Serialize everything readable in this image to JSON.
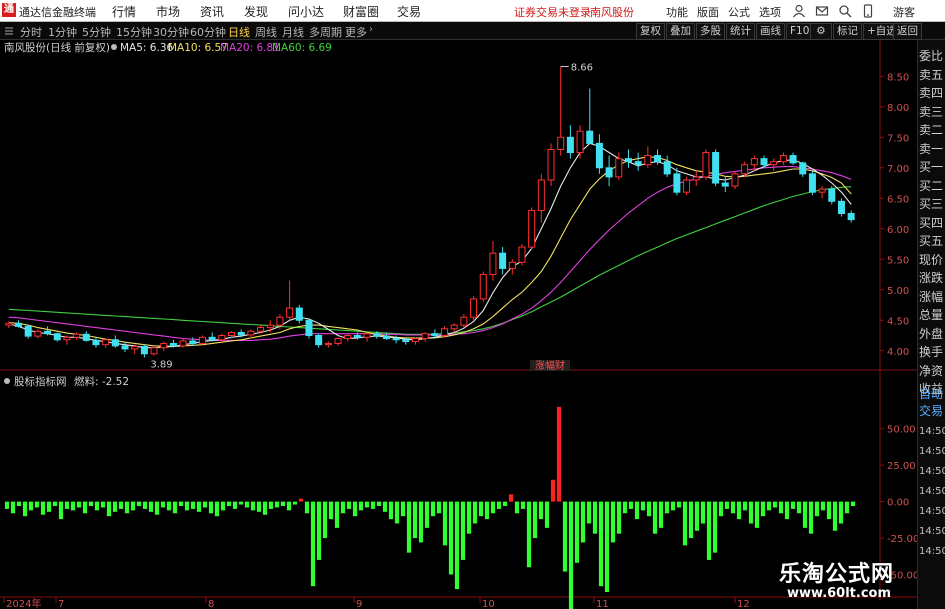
{
  "titlebar": {
    "logo": "通",
    "app_title": "通达信金融终端",
    "menu": [
      "行情",
      "市场",
      "资讯",
      "发现",
      "问小达",
      "财富圈",
      "交易"
    ],
    "notice": "证券交易未登录",
    "stock_tab": "南风股份",
    "right_items": [
      "功能",
      "版面",
      "公式",
      "选项"
    ],
    "guest": "游客"
  },
  "toolbar": {
    "periods": [
      "分时",
      "1分钟",
      "5分钟",
      "15分钟",
      "30分钟",
      "60分钟",
      "日线",
      "周线",
      "月线",
      "多周期",
      "更多"
    ],
    "active_period": "日线",
    "buttons": [
      "复权",
      "叠加",
      "多股",
      "统计",
      "画线",
      "F10",
      "标记",
      "+自选",
      "返回"
    ]
  },
  "main_chart": {
    "info": {
      "name": "南风股份(日线 前复权)",
      "ma5": "MA5: 6.36",
      "ma10": "MA10: 6.57",
      "ma20": "MA20: 6.81",
      "ma60": "MA60: 6.69"
    },
    "colors": {
      "ma5": "#e8e8e8",
      "ma10": "#f0e060",
      "ma20": "#e040e0",
      "ma60": "#40d040",
      "up": "#ff3030",
      "down": "#40e0f0"
    },
    "high_label": "8.66",
    "low_label": "3.89",
    "y_ticks": [
      "8.50",
      "8.00",
      "7.50",
      "7.00",
      "6.50",
      "6.00",
      "5.50",
      "5.00",
      "4.50",
      "4.00"
    ],
    "indicator_tag": "涨幅财"
  },
  "indicator": {
    "name": "股标指标网",
    "value_label": "燃料: -2.52",
    "y_ticks": [
      "50.00",
      "25.00",
      "0.00",
      "-25.00",
      "-50.00"
    ],
    "colors": {
      "positive": "#ff2020",
      "negative": "#30ff30"
    }
  },
  "x_axis": {
    "labels": [
      "2024年",
      "7",
      "8",
      "9",
      "10",
      "11",
      "12"
    ]
  },
  "sidebar": {
    "items": [
      "委比",
      "卖五",
      "卖四",
      "卖三",
      "卖二",
      "卖一",
      "买一",
      "买二",
      "买三",
      "买四",
      "买五",
      "现价",
      "涨跌",
      "涨幅",
      "总量",
      "外盘",
      "换手",
      "净资",
      "收益"
    ],
    "blue_items": [
      "自动",
      "交易"
    ],
    "times": [
      "14:50",
      "14:50",
      "14:50",
      "14:50",
      "14:50",
      "14:50",
      "14:50"
    ]
  },
  "watermark": {
    "line1": "乐淘公式网",
    "line2": "www.60lt.com"
  },
  "chart_data": {
    "type": "candlestick",
    "y_range": [
      3.75,
      8.8
    ],
    "candles": [
      [
        4.42,
        4.48,
        4.37,
        4.45
      ],
      [
        4.45,
        4.5,
        4.38,
        4.4
      ],
      [
        4.4,
        4.42,
        4.2,
        4.24
      ],
      [
        4.24,
        4.35,
        4.2,
        4.32
      ],
      [
        4.32,
        4.4,
        4.25,
        4.28
      ],
      [
        4.28,
        4.3,
        4.15,
        4.18
      ],
      [
        4.18,
        4.25,
        4.1,
        4.22
      ],
      [
        4.22,
        4.3,
        4.18,
        4.27
      ],
      [
        4.27,
        4.32,
        4.15,
        4.17
      ],
      [
        4.17,
        4.22,
        4.05,
        4.1
      ],
      [
        4.1,
        4.2,
        4.05,
        4.18
      ],
      [
        4.18,
        4.25,
        4.05,
        4.08
      ],
      [
        4.08,
        4.15,
        3.98,
        4.03
      ],
      [
        4.03,
        4.1,
        3.95,
        4.07
      ],
      [
        4.07,
        4.1,
        3.89,
        3.95
      ],
      [
        3.95,
        4.08,
        3.92,
        4.05
      ],
      [
        4.05,
        4.15,
        4.0,
        4.12
      ],
      [
        4.12,
        4.18,
        4.05,
        4.08
      ],
      [
        4.08,
        4.2,
        4.05,
        4.16
      ],
      [
        4.16,
        4.22,
        4.08,
        4.12
      ],
      [
        4.12,
        4.25,
        4.1,
        4.22
      ],
      [
        4.22,
        4.3,
        4.15,
        4.18
      ],
      [
        4.18,
        4.28,
        4.12,
        4.25
      ],
      [
        4.25,
        4.32,
        4.2,
        4.3
      ],
      [
        4.3,
        4.35,
        4.22,
        4.26
      ],
      [
        4.26,
        4.35,
        4.2,
        4.32
      ],
      [
        4.32,
        4.42,
        4.28,
        4.38
      ],
      [
        4.38,
        4.5,
        4.3,
        4.42
      ],
      [
        4.42,
        4.6,
        4.35,
        4.55
      ],
      [
        4.55,
        5.15,
        4.5,
        4.7
      ],
      [
        4.7,
        4.75,
        4.45,
        4.5
      ],
      [
        4.5,
        4.52,
        4.2,
        4.25
      ],
      [
        4.25,
        4.28,
        4.05,
        4.1
      ],
      [
        4.1,
        4.15,
        4.05,
        4.12
      ],
      [
        4.12,
        4.22,
        4.08,
        4.2
      ],
      [
        4.2,
        4.28,
        4.15,
        4.25
      ],
      [
        4.25,
        4.3,
        4.18,
        4.22
      ],
      [
        4.22,
        4.3,
        4.15,
        4.28
      ],
      [
        4.28,
        4.32,
        4.2,
        4.24
      ],
      [
        4.24,
        4.3,
        4.18,
        4.2
      ],
      [
        4.2,
        4.25,
        4.12,
        4.18
      ],
      [
        4.18,
        4.22,
        4.1,
        4.15
      ],
      [
        4.15,
        4.22,
        4.1,
        4.2
      ],
      [
        4.2,
        4.3,
        4.15,
        4.28
      ],
      [
        4.28,
        4.35,
        4.2,
        4.25
      ],
      [
        4.25,
        4.4,
        4.22,
        4.36
      ],
      [
        4.36,
        4.45,
        4.3,
        4.42
      ],
      [
        4.42,
        4.6,
        4.38,
        4.55
      ],
      [
        4.55,
        4.9,
        4.5,
        4.85
      ],
      [
        4.85,
        5.3,
        4.8,
        5.25
      ],
      [
        5.25,
        5.8,
        5.15,
        5.6
      ],
      [
        5.6,
        5.7,
        5.25,
        5.35
      ],
      [
        5.35,
        5.5,
        5.25,
        5.45
      ],
      [
        5.45,
        5.75,
        5.4,
        5.7
      ],
      [
        5.7,
        6.35,
        5.65,
        6.3
      ],
      [
        6.3,
        6.9,
        6.1,
        6.8
      ],
      [
        6.8,
        7.4,
        6.7,
        7.3
      ],
      [
        7.3,
        8.66,
        7.2,
        7.5
      ],
      [
        7.5,
        7.7,
        7.15,
        7.25
      ],
      [
        7.25,
        7.7,
        7.15,
        7.6
      ],
      [
        7.6,
        8.3,
        7.55,
        7.4
      ],
      [
        7.4,
        7.55,
        6.9,
        7.0
      ],
      [
        7.0,
        7.2,
        6.7,
        6.85
      ],
      [
        6.85,
        7.25,
        6.8,
        7.15
      ],
      [
        7.15,
        7.3,
        7.0,
        7.1
      ],
      [
        7.1,
        7.25,
        6.95,
        7.05
      ],
      [
        7.05,
        7.35,
        7.0,
        7.2
      ],
      [
        7.2,
        7.3,
        7.05,
        7.1
      ],
      [
        7.1,
        7.2,
        6.85,
        6.9
      ],
      [
        6.9,
        7.0,
        6.55,
        6.6
      ],
      [
        6.6,
        6.85,
        6.55,
        6.8
      ],
      [
        6.8,
        6.95,
        6.7,
        6.85
      ],
      [
        6.85,
        7.3,
        6.8,
        7.25
      ],
      [
        7.25,
        7.3,
        6.7,
        6.75
      ],
      [
        6.75,
        6.85,
        6.6,
        6.7
      ],
      [
        6.7,
        6.95,
        6.65,
        6.9
      ],
      [
        6.9,
        7.1,
        6.85,
        7.05
      ],
      [
        7.05,
        7.2,
        6.95,
        7.15
      ],
      [
        7.15,
        7.2,
        7.0,
        7.05
      ],
      [
        7.05,
        7.15,
        6.95,
        7.1
      ],
      [
        7.1,
        7.25,
        7.05,
        7.2
      ],
      [
        7.2,
        7.25,
        7.05,
        7.08
      ],
      [
        7.08,
        7.1,
        6.85,
        6.9
      ],
      [
        6.9,
        6.95,
        6.55,
        6.6
      ],
      [
        6.6,
        6.7,
        6.5,
        6.65
      ],
      [
        6.65,
        6.7,
        6.4,
        6.45
      ],
      [
        6.45,
        6.5,
        6.2,
        6.25
      ],
      [
        6.25,
        6.3,
        6.1,
        6.15
      ]
    ],
    "ma5_line": [
      4.44,
      4.4,
      4.34,
      4.3,
      4.28,
      4.25,
      4.22,
      4.22,
      4.2,
      4.17,
      4.15,
      4.12,
      4.1,
      4.08,
      4.05,
      4.05,
      4.06,
      4.07,
      4.1,
      4.12,
      4.15,
      4.17,
      4.19,
      4.22,
      4.24,
      4.27,
      4.3,
      4.34,
      4.4,
      4.5,
      4.55,
      4.52,
      4.45,
      4.35,
      4.25,
      4.2,
      4.21,
      4.23,
      4.24,
      4.23,
      4.21,
      4.19,
      4.18,
      4.2,
      4.22,
      4.26,
      4.3,
      4.37,
      4.48,
      4.66,
      4.95,
      5.2,
      5.38,
      5.47,
      5.68,
      6.0,
      6.33,
      6.7,
      7.0,
      7.25,
      7.4,
      7.35,
      7.25,
      7.15,
      7.1,
      7.03,
      7.08,
      7.1,
      7.05,
      6.95,
      6.9,
      6.85,
      6.85,
      6.82,
      6.8,
      6.84,
      6.88,
      6.95,
      7.02,
      7.08,
      7.12,
      7.13,
      7.07,
      6.98,
      6.88,
      6.75,
      6.6,
      6.4
    ],
    "ma10_line": [
      4.46,
      4.45,
      4.42,
      4.38,
      4.35,
      4.32,
      4.29,
      4.27,
      4.25,
      4.22,
      4.19,
      4.17,
      4.14,
      4.12,
      4.1,
      4.08,
      4.08,
      4.07,
      4.08,
      4.09,
      4.1,
      4.12,
      4.14,
      4.16,
      4.18,
      4.21,
      4.24,
      4.27,
      4.3,
      4.36,
      4.4,
      4.42,
      4.42,
      4.4,
      4.38,
      4.36,
      4.34,
      4.3,
      4.27,
      4.24,
      4.22,
      4.21,
      4.21,
      4.21,
      4.21,
      4.23,
      4.26,
      4.3,
      4.36,
      4.44,
      4.56,
      4.7,
      4.84,
      4.96,
      5.12,
      5.3,
      5.55,
      5.85,
      6.15,
      6.4,
      6.65,
      6.82,
      6.95,
      7.05,
      7.12,
      7.15,
      7.18,
      7.17,
      7.12,
      7.05,
      7.0,
      6.95,
      6.93,
      6.9,
      6.86,
      6.85,
      6.86,
      6.88,
      6.9,
      6.92,
      6.95,
      6.98,
      6.98,
      6.95,
      6.9,
      6.84,
      6.75,
      6.57
    ],
    "ma20_line": [
      4.55,
      4.54,
      4.52,
      4.5,
      4.48,
      4.46,
      4.44,
      4.42,
      4.4,
      4.38,
      4.36,
      4.34,
      4.32,
      4.3,
      4.28,
      4.26,
      4.24,
      4.22,
      4.2,
      4.19,
      4.18,
      4.17,
      4.17,
      4.17,
      4.17,
      4.17,
      4.18,
      4.19,
      4.21,
      4.24,
      4.26,
      4.28,
      4.28,
      4.28,
      4.28,
      4.28,
      4.28,
      4.28,
      4.28,
      4.27,
      4.27,
      4.26,
      4.26,
      4.26,
      4.26,
      4.26,
      4.27,
      4.28,
      4.3,
      4.33,
      4.38,
      4.44,
      4.52,
      4.6,
      4.7,
      4.82,
      4.96,
      5.12,
      5.3,
      5.48,
      5.66,
      5.82,
      5.98,
      6.12,
      6.26,
      6.38,
      6.5,
      6.6,
      6.68,
      6.74,
      6.78,
      6.82,
      6.86,
      6.89,
      6.92,
      6.94,
      6.96,
      6.98,
      7.0,
      7.01,
      7.02,
      7.02,
      7.0,
      6.98,
      6.95,
      6.92,
      6.87,
      6.81
    ],
    "ma60_line": [
      4.68,
      4.67,
      4.66,
      4.65,
      4.64,
      4.63,
      4.62,
      4.61,
      4.6,
      4.59,
      4.58,
      4.57,
      4.56,
      4.55,
      4.54,
      4.53,
      4.52,
      4.51,
      4.5,
      4.49,
      4.48,
      4.47,
      4.46,
      4.45,
      4.44,
      4.43,
      4.42,
      4.41,
      4.4,
      4.39,
      4.38,
      4.37,
      4.36,
      4.35,
      4.34,
      4.33,
      4.32,
      4.31,
      4.3,
      4.29,
      4.28,
      4.27,
      4.27,
      4.27,
      4.27,
      4.28,
      4.29,
      4.31,
      4.33,
      4.36,
      4.4,
      4.45,
      4.51,
      4.57,
      4.64,
      4.72,
      4.8,
      4.88,
      4.97,
      5.06,
      5.15,
      5.24,
      5.32,
      5.4,
      5.48,
      5.56,
      5.63,
      5.7,
      5.77,
      5.84,
      5.9,
      5.96,
      6.02,
      6.08,
      6.14,
      6.2,
      6.26,
      6.32,
      6.38,
      6.43,
      6.48,
      6.53,
      6.57,
      6.61,
      6.64,
      6.66,
      6.68,
      6.69
    ],
    "indicator_range": [
      -62,
      80
    ],
    "indicator_values": [
      -5,
      -8,
      -3,
      -10,
      -6,
      -4,
      -9,
      -7,
      -3,
      -12,
      -5,
      -6,
      -4,
      -8,
      -3,
      -6,
      -4,
      -10,
      -7,
      -5,
      -8,
      -6,
      -3,
      -5,
      -7,
      -9,
      -4,
      -6,
      -8,
      -3,
      -6,
      -5,
      -7,
      -4,
      -8,
      -10,
      -6,
      -3,
      -5,
      -2,
      -4,
      -6,
      -7,
      -9,
      -5,
      -4,
      -3,
      -6,
      -2,
      2,
      -8,
      -58,
      -40,
      -25,
      -12,
      -18,
      -8,
      -5,
      -10,
      -6,
      -4,
      -5,
      -3,
      -7,
      -12,
      -15,
      -10,
      -35,
      -25,
      -28,
      -18,
      -10,
      -8,
      -30,
      -50,
      -60,
      -40,
      -22,
      -15,
      -10,
      -12,
      -8,
      -5,
      -3,
      5,
      -8,
      -5,
      -45,
      -25,
      -12,
      -18,
      15,
      65,
      -48,
      -75,
      -42,
      -28,
      -15,
      -22,
      -58,
      -62,
      -28,
      -22,
      -8,
      -5,
      -12,
      -6,
      -10,
      -22,
      -18,
      -8,
      -6,
      -4,
      -30,
      -25,
      -20,
      -15,
      -40,
      -35,
      -10,
      -5,
      -8,
      -12,
      -6,
      -15,
      -18,
      -10,
      -6,
      -4,
      -8,
      -12,
      -5,
      -8,
      -18,
      -22,
      -10,
      -6,
      -12,
      -20,
      -15,
      -8,
      -3
    ]
  }
}
